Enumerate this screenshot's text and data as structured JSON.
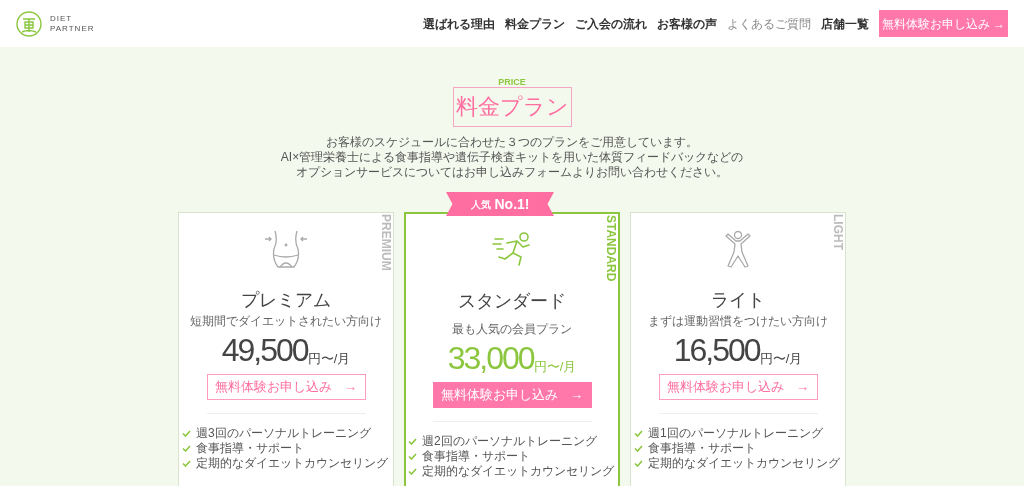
{
  "header": {
    "logo_text": [
      "DIET",
      "PARTNER"
    ],
    "nav": [
      {
        "label": "選ばれる理由",
        "dimmed": false
      },
      {
        "label": "料金プラン",
        "dimmed": false
      },
      {
        "label": "ご入会の流れ",
        "dimmed": false
      },
      {
        "label": "お客様の声",
        "dimmed": false
      },
      {
        "label": "よくあるご質問",
        "dimmed": true
      },
      {
        "label": "店舗一覧",
        "dimmed": false
      }
    ],
    "cta": "無料体験お申し込み →"
  },
  "section": {
    "eyebrow": "PRICE",
    "title": "料金プラン",
    "intro": [
      "お客様のスケジュールに合わせた３つのプランをご用意しています。",
      "AI×管理栄養士による食事指導や遺伝子検査キットを用いた体質フィードバックなどの",
      "オプションサービスについてはお申し込みフォームよりお問い合わせください。"
    ]
  },
  "plans": [
    {
      "tag": "PREMIUM",
      "kind": "waist",
      "name": "プレミアム",
      "tagline": "短期間でダイエットされたい方向け",
      "price": "49,500",
      "unit": "円〜/月",
      "button": "無料体験お申し込み",
      "arrow": "→",
      "featured": false,
      "features": [
        "週3回のパーソナルトレーニング",
        "食事指導・サポート",
        "定期的なダイエットカウンセリング"
      ]
    },
    {
      "tag": "STANDARD",
      "kind": "runner",
      "badge": [
        "人気",
        "No.1!"
      ],
      "name": "スタンダード",
      "tagline": "最も人気の会員プラン",
      "price": "33,000",
      "unit": "円〜/月",
      "button": "無料体験お申し込み",
      "arrow": "→",
      "featured": true,
      "features": [
        "週2回のパーソナルトレーニング",
        "食事指導・サポート",
        "定期的なダイエットカウンセリング"
      ]
    },
    {
      "tag": "LIGHT",
      "kind": "stretch",
      "name": "ライト",
      "tagline": "まずは運動習慣をつけたい方向け",
      "price": "16,500",
      "unit": "円〜/月",
      "button": "無料体験お申し込み",
      "arrow": "→",
      "featured": false,
      "features": [
        "週1回のパーソナルトレーニング",
        "食事指導・サポート",
        "定期的なダイエットカウンセリング"
      ]
    }
  ]
}
